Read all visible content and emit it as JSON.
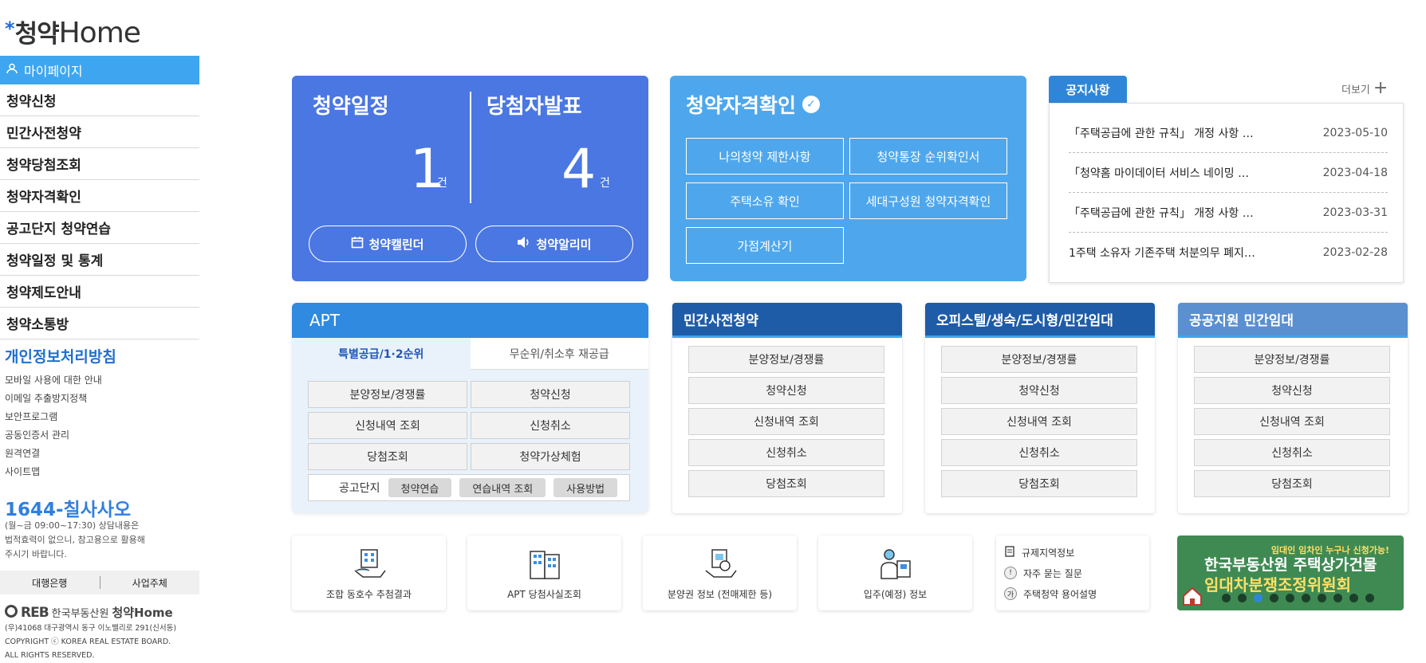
{
  "logo": {
    "star": "*",
    "kor": "청약",
    "eng": "Home"
  },
  "sidebar": {
    "mypage": "마이페이지",
    "items": [
      "청약신청",
      "민간사전청약",
      "청약당첨조회",
      "청약자격확인",
      "공고단지 청약연습",
      "청약일정 및 통계",
      "청약제도안내",
      "청약소통방"
    ],
    "privacy_title": "개인정보처리방침",
    "sub_links": [
      "모바일 사용에 대한 안내",
      "이메일 추출방지정책",
      "보안프로그램",
      "공동인증서 관리",
      "원격연결",
      "사이트맵"
    ],
    "phone": "1644-칠사사오",
    "hours": [
      "(월~금 09:00~17:30) 상담내용은",
      "법적효력이 없으니, 참고용으로 활용해",
      "주시기 바랍니다."
    ],
    "bank": "대행은행",
    "org": "사업주체",
    "reb_logo": "REB",
    "reb_name": "한국부동산원",
    "reb_brand": "청약Home",
    "address": [
      "(우)41068 대구광역시 동구 이노밸리로 291(신서동)",
      "COPYRIGHT ⓒ KOREA REAL ESTATE BOARD.",
      "ALL RIGHTS RESERVED."
    ]
  },
  "schedule": {
    "title": "청약일정",
    "count": "1",
    "unit": "건",
    "winners_title": "당첨자발표",
    "winners_count": "4",
    "winners_unit": "건",
    "calendar_btn": "청약캘린더",
    "alarm_btn": "청약알리미"
  },
  "qualify": {
    "title": "청약자격확인",
    "buttons": [
      "나의청약 제한사항",
      "청약통장 순위확인서",
      "주택소유 확인",
      "세대구성원 청약자격확인",
      "가점계산기"
    ]
  },
  "notice": {
    "tab": "공지사항",
    "more": "더보기",
    "items": [
      {
        "title": "「주택공급에 관한 규칙」 개정 사항 …",
        "date": "2023-05-10"
      },
      {
        "title": "「청약홈 마이데이터 서비스 네이밍 …",
        "date": "2023-04-18"
      },
      {
        "title": "「주택공급에 관한 규칙」 개정 사항 …",
        "date": "2023-03-31"
      },
      {
        "title": "1주택 소유자 기존주택 처분의무 폐지…",
        "date": "2023-02-28"
      }
    ]
  },
  "apt": {
    "title": "APT",
    "tab_on": "특별공급/1·2순위",
    "tab_off": "무순위/취소후 재공급",
    "buttons": [
      "분양정보/경쟁률",
      "청약신청",
      "신청내역 조회",
      "신청취소",
      "당첨조회",
      "청약가상체험"
    ],
    "practice_label": "공고단지",
    "chips": [
      "청약연습",
      "연습내역 조회",
      "사용방법"
    ]
  },
  "cards": [
    {
      "title": "민간사전청약",
      "buttons": [
        "분양정보/경쟁률",
        "청약신청",
        "신청내역 조회",
        "신청취소",
        "당첨조회"
      ]
    },
    {
      "title": "오피스텔/생숙/도시형/민간임대",
      "buttons": [
        "분양정보/경쟁률",
        "청약신청",
        "신청내역 조회",
        "신청취소",
        "당첨조회"
      ]
    },
    {
      "title": "공공지원 민간임대",
      "buttons": [
        "분양정보/경쟁률",
        "청약신청",
        "신청내역 조회",
        "신청취소",
        "당첨조회"
      ]
    }
  ],
  "bottom": {
    "tiles": [
      "조합 동호수 추첨결과",
      "APT 당첨사실조회",
      "분양권 정보 (전매제한 등)",
      "입주(예정) 정보"
    ],
    "links": [
      {
        "badge": "",
        "label": "규제지역정보"
      },
      {
        "badge": "!",
        "label": "자주 묻는 질문"
      },
      {
        "badge": "가",
        "label": "주택청약 용어설명"
      }
    ],
    "banner": {
      "line1": "임대인 임차인 누구나 신청가능!",
      "line2": "한국부동산원 주택상가건물",
      "line3": "임대차분쟁조정위원회"
    }
  },
  "colors": {
    "accent": "#3ea6f0",
    "schedule_bg": "#4a77e2",
    "qualify_bg": "#4ea7ec",
    "card_header": "#1f5ca8",
    "banner_bg": "#3f8a53"
  }
}
